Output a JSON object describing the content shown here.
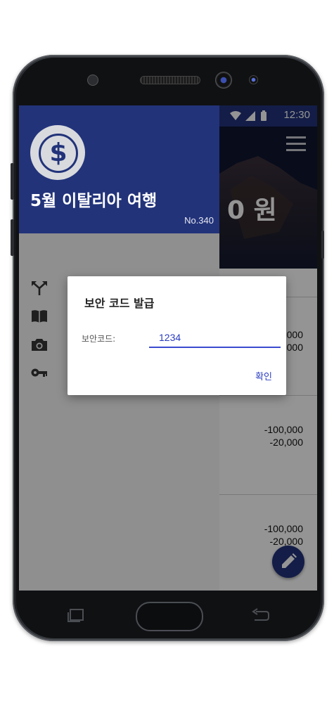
{
  "status_bar": {
    "time": "12:30"
  },
  "header": {
    "amount_fragment": "0 원"
  },
  "list": {
    "rows": [
      {
        "values": [
          "000",
          "000"
        ]
      },
      {
        "values": [
          "-100,000",
          "-20,000"
        ]
      },
      {
        "values": [
          "-100,000",
          "-20,000"
        ]
      }
    ]
  },
  "drawer": {
    "title": "5월 이탈리아 여행",
    "number": "No.340",
    "menu_icons": [
      "split-icon",
      "book-icon",
      "camera-icon",
      "key-icon"
    ]
  },
  "dialog": {
    "title": "보안 코드 발급",
    "field_label": "보안코드:",
    "field_value": "1234",
    "confirm_label": "확인"
  },
  "colors": {
    "primary": "#22337a",
    "accent": "#2a3cc0",
    "drawer_bg": "#8f8f8f"
  }
}
